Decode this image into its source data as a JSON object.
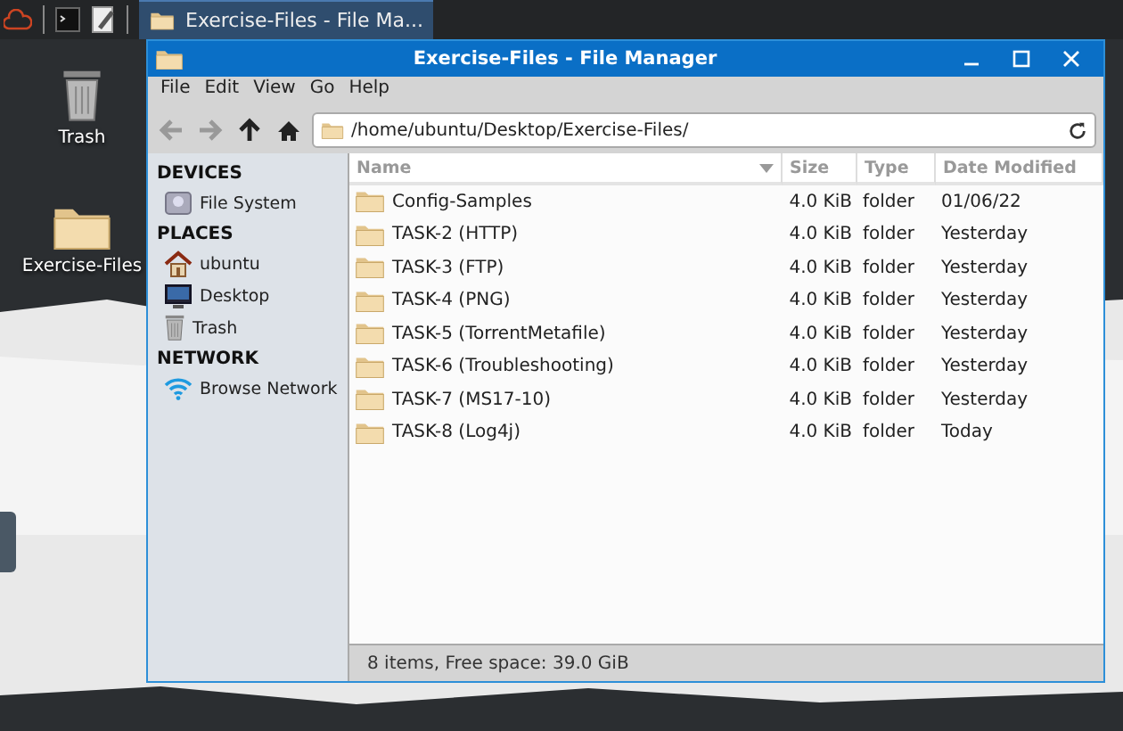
{
  "taskbar": {
    "tasks": [
      {
        "label": "Exercise-Files - File Ma...",
        "selected": true
      }
    ]
  },
  "desktop_icons": [
    {
      "label": "Trash",
      "kind": "trash"
    },
    {
      "label": "Exercise-Files",
      "kind": "folder"
    }
  ],
  "window": {
    "title": "Exercise-Files - File Manager",
    "menu": [
      "File",
      "Edit",
      "View",
      "Go",
      "Help"
    ],
    "location": "/home/ubuntu/Desktop/Exercise-Files/",
    "sidebar": [
      {
        "heading": "DEVICES",
        "items": [
          {
            "label": "File System",
            "kind": "drive"
          }
        ]
      },
      {
        "heading": "PLACES",
        "items": [
          {
            "label": "ubuntu",
            "kind": "home"
          },
          {
            "label": "Desktop",
            "kind": "desktop"
          },
          {
            "label": "Trash",
            "kind": "trash"
          }
        ]
      },
      {
        "heading": "NETWORK",
        "items": [
          {
            "label": "Browse Network",
            "kind": "network"
          }
        ]
      }
    ],
    "columns": [
      "Name",
      "Size",
      "Type",
      "Date Modified"
    ],
    "rows": [
      {
        "name": "Config-Samples",
        "size": "4.0 KiB",
        "type": "folder",
        "date": "01/06/22"
      },
      {
        "name": "TASK-2 (HTTP)",
        "size": "4.0 KiB",
        "type": "folder",
        "date": "Yesterday"
      },
      {
        "name": "TASK-3 (FTP)",
        "size": "4.0 KiB",
        "type": "folder",
        "date": "Yesterday"
      },
      {
        "name": "TASK-4 (PNG)",
        "size": "4.0 KiB",
        "type": "folder",
        "date": "Yesterday"
      },
      {
        "name": "TASK-5 (TorrentMetafile)",
        "size": "4.0 KiB",
        "type": "folder",
        "date": "Yesterday"
      },
      {
        "name": "TASK-6 (Troubleshooting)",
        "size": "4.0 KiB",
        "type": "folder",
        "date": "Yesterday"
      },
      {
        "name": "TASK-7 (MS17-10)",
        "size": "4.0 KiB",
        "type": "folder",
        "date": "Yesterday"
      },
      {
        "name": "TASK-8 (Log4j)",
        "size": "4.0 KiB",
        "type": "folder",
        "date": "Today"
      }
    ],
    "status_bar": "8 items, Free space: 39.0 GiB"
  }
}
